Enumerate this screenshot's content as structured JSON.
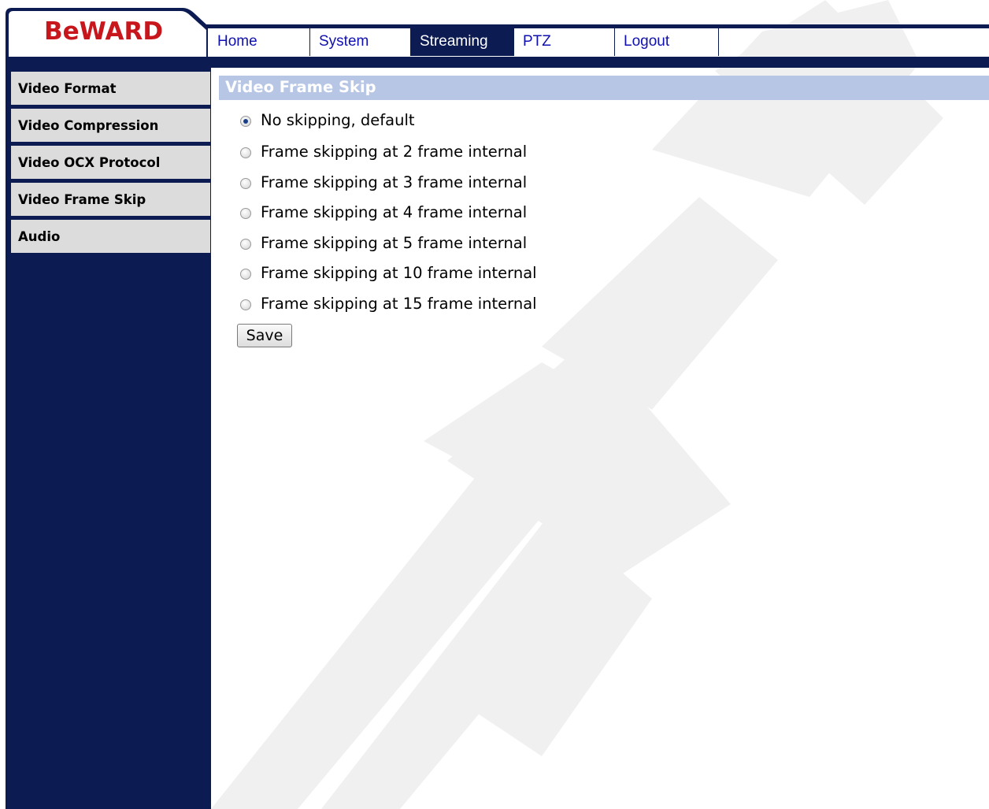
{
  "brand": {
    "logo_text": "BeWARD",
    "logo_color": "#c8161d"
  },
  "nav": {
    "tabs": [
      {
        "label": "Home"
      },
      {
        "label": "System"
      },
      {
        "label": "Streaming",
        "active": true
      },
      {
        "label": "PTZ"
      },
      {
        "label": "Logout"
      }
    ]
  },
  "sidebar": {
    "items": [
      {
        "label": "Video Format"
      },
      {
        "label": "Video Compression"
      },
      {
        "label": "Video OCX Protocol"
      },
      {
        "label": "Video Frame Skip"
      },
      {
        "label": "Audio"
      }
    ]
  },
  "main": {
    "section_title": "Video Frame Skip",
    "options": [
      {
        "label": "No skipping, default",
        "checked": true
      },
      {
        "label": "Frame skipping at 2 frame internal",
        "checked": false
      },
      {
        "label": "Frame skipping at 3 frame internal",
        "checked": false
      },
      {
        "label": "Frame skipping at 4 frame internal",
        "checked": false
      },
      {
        "label": "Frame skipping at 5 frame internal",
        "checked": false
      },
      {
        "label": "Frame skipping at 10 frame internal",
        "checked": false
      },
      {
        "label": "Frame skipping at 15 frame internal",
        "checked": false
      }
    ],
    "save_label": "Save"
  },
  "colors": {
    "navy": "#0c1c52",
    "nav_link": "#1010b0",
    "section_bar": "#b7c6e4",
    "sidebar_item": "#dcdcdc"
  }
}
